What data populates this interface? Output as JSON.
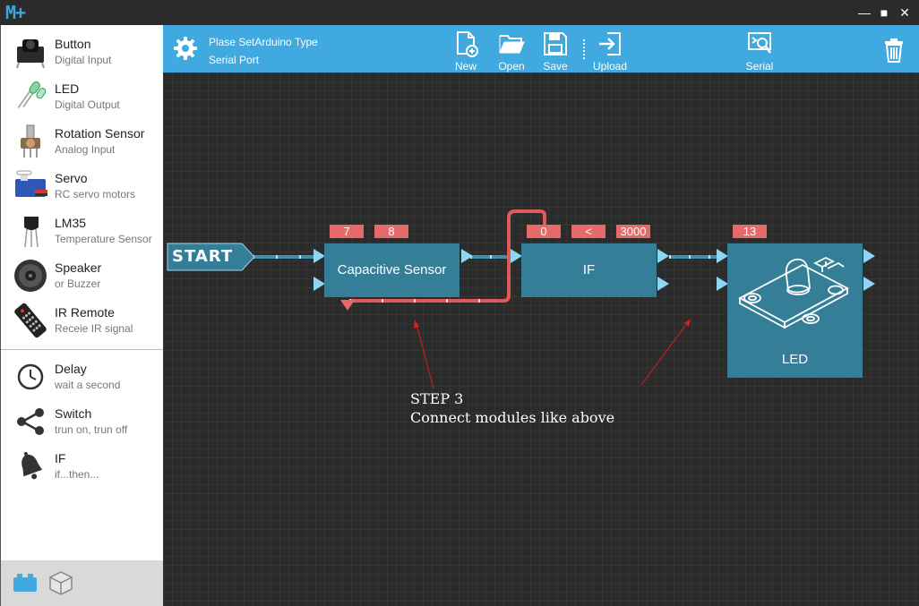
{
  "app": {
    "logo": "M+"
  },
  "window": {
    "minimize": "—",
    "maximize": "■",
    "close": "✕"
  },
  "sidebar": {
    "items": [
      {
        "title": "Button",
        "subtitle": "Digital Input",
        "icon": "pushbutton-icon"
      },
      {
        "title": "LED",
        "subtitle": "Digital Output",
        "icon": "led-icon"
      },
      {
        "title": "Rotation Sensor",
        "subtitle": "Analog Input",
        "icon": "potentiometer-icon"
      },
      {
        "title": "Servo",
        "subtitle": "RC servo motors",
        "icon": "servo-icon"
      },
      {
        "title": "LM35",
        "subtitle": "Temperature Sensor",
        "icon": "temperature-sensor-icon"
      },
      {
        "title": "Speaker",
        "subtitle": "or Buzzer",
        "icon": "speaker-icon"
      },
      {
        "title": "IR Remote",
        "subtitle": "Receie IR signal",
        "icon": "ir-remote-icon"
      },
      {
        "title": "Delay",
        "subtitle": "wait a second",
        "icon": "clock-icon"
      },
      {
        "title": "Switch",
        "subtitle": "trun on, trun off",
        "icon": "share-icon"
      },
      {
        "title": "IF",
        "subtitle": "if...then...",
        "icon": "bell-icon"
      }
    ],
    "footer": [
      "blocks-icon",
      "cube-icon"
    ]
  },
  "toolbar": {
    "arduino_type": "Plase SetArduino Type",
    "serial_port": "Serial Port",
    "new_label": "New",
    "open_label": "Open",
    "save_label": "Save",
    "upload_label": "Upload",
    "serial_label": "Serial"
  },
  "canvas": {
    "start_label": "START",
    "blocks": {
      "capacitive": {
        "title": "Capacitive Sensor",
        "params": [
          "7",
          "8"
        ]
      },
      "if": {
        "title": "IF",
        "params": [
          "0",
          "<",
          "3000"
        ]
      },
      "led": {
        "title": "LED",
        "params": [
          "13"
        ]
      }
    },
    "instruction": "STEP 3\nConnect modules like above"
  },
  "colors": {
    "toolbar": "#3fa9e0",
    "block": "#347e98",
    "param": "#e66a6a",
    "port": "#8fd6f2",
    "wire": "#3f8fb0",
    "loop_wire": "#e05a5a",
    "arrow": "#d81e1e",
    "canvas": "#2b2b2b"
  }
}
